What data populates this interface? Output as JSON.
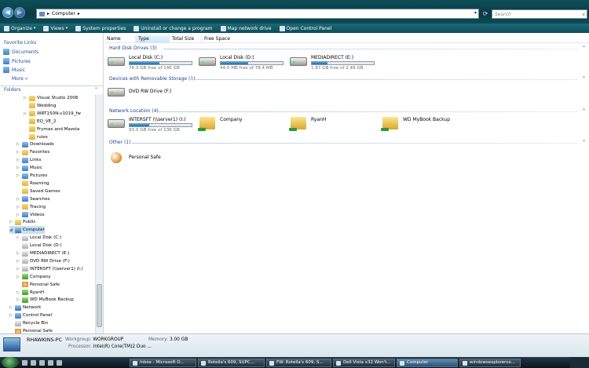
{
  "address": {
    "path": [
      "Computer"
    ]
  },
  "search": {
    "placeholder": "Search"
  },
  "toolbar": [
    {
      "label": "Organize",
      "icon": "organize-icon",
      "dropdown": true
    },
    {
      "label": "Views",
      "icon": "views-icon",
      "dropdown": true
    },
    {
      "label": "System properties",
      "icon": "system-properties-icon"
    },
    {
      "label": "Uninstall or change a program",
      "icon": "uninstall-icon"
    },
    {
      "label": "Map network drive",
      "icon": "map-drive-icon"
    },
    {
      "label": "Open Control Panel",
      "icon": "control-panel-icon"
    }
  ],
  "favorites": {
    "header": "Favorite Links",
    "items": [
      "Documents",
      "Pictures",
      "Music"
    ],
    "more": "More"
  },
  "folders": {
    "header": "Folders"
  },
  "tree": [
    {
      "label": "Visual Studio 2008",
      "icon": "folder",
      "depth": 2,
      "exp": "▷"
    },
    {
      "label": "Wedding",
      "icon": "folder",
      "depth": 2,
      "exp": ""
    },
    {
      "label": "WRT150N-v1019_fw",
      "icon": "folder",
      "depth": 2,
      "exp": "▷"
    },
    {
      "label": "EQ_VE_2",
      "icon": "folder",
      "depth": 2,
      "exp": ""
    },
    {
      "label": "Frymax and Mazola",
      "icon": "folder",
      "depth": 2,
      "exp": ""
    },
    {
      "label": "rules",
      "icon": "folder",
      "depth": 2,
      "exp": ""
    },
    {
      "label": "Downloads",
      "icon": "blue",
      "depth": 1,
      "exp": "▷"
    },
    {
      "label": "Favorites",
      "icon": "folder",
      "depth": 1,
      "exp": "▷"
    },
    {
      "label": "Links",
      "icon": "blue",
      "depth": 1,
      "exp": "▷"
    },
    {
      "label": "Music",
      "icon": "blue",
      "depth": 1,
      "exp": "▷"
    },
    {
      "label": "Pictures",
      "icon": "blue",
      "depth": 1,
      "exp": "▷"
    },
    {
      "label": "Roaming",
      "icon": "folder",
      "depth": 1,
      "exp": ""
    },
    {
      "label": "Saved Games",
      "icon": "folder",
      "depth": 1,
      "exp": ""
    },
    {
      "label": "Searches",
      "icon": "blue",
      "depth": 1,
      "exp": "▷"
    },
    {
      "label": "Tracing",
      "icon": "folder",
      "depth": 1,
      "exp": "▷"
    },
    {
      "label": "Videos",
      "icon": "blue",
      "depth": 1,
      "exp": "▷"
    },
    {
      "label": "Public",
      "icon": "folder",
      "depth": 0,
      "exp": "▷"
    },
    {
      "label": "Computer",
      "icon": "pc",
      "depth": 0,
      "exp": "◢",
      "selected": true
    },
    {
      "label": "Local Disk (C:)",
      "icon": "drive",
      "depth": 1,
      "exp": "▷"
    },
    {
      "label": "Local Disk (D:)",
      "icon": "drive",
      "depth": 1,
      "exp": ""
    },
    {
      "label": "MEDIADIRECT (E:)",
      "icon": "drive",
      "depth": 1,
      "exp": "▷"
    },
    {
      "label": "DVD RW Drive (F:)",
      "icon": "drive",
      "depth": 1,
      "exp": "▷"
    },
    {
      "label": "INTERSFT (\\\\server1) (I:)",
      "icon": "drive",
      "depth": 1,
      "exp": "▷"
    },
    {
      "label": "Company",
      "icon": "green",
      "depth": 1,
      "exp": "▷"
    },
    {
      "label": "Personal Safe",
      "icon": "orange",
      "depth": 1,
      "exp": ""
    },
    {
      "label": "RyanH",
      "icon": "green",
      "depth": 1,
      "exp": "▷"
    },
    {
      "label": "WD MyBook Backup",
      "icon": "green",
      "depth": 1,
      "exp": "▷"
    },
    {
      "label": "Network",
      "icon": "pc",
      "depth": 0,
      "exp": "▷"
    },
    {
      "label": "Control Panel",
      "icon": "blue",
      "depth": 0,
      "exp": "▷"
    },
    {
      "label": "Recycle Bin",
      "icon": "drive",
      "depth": 0,
      "exp": ""
    },
    {
      "label": "Personal Safe",
      "icon": "orange",
      "depth": 0,
      "exp": ""
    }
  ],
  "columns": [
    "Name",
    "Type",
    "Total Size",
    "Free Space"
  ],
  "groups": [
    {
      "title": "Hard Disk Drives (3)",
      "items": [
        {
          "name": "Local Disk (C:)",
          "kind": "hdd",
          "free": "76.3 GB free of 146 GB",
          "used_fraction": 0.48
        },
        {
          "name": "Local Disk (D:)",
          "kind": "hdd",
          "free": "44.0 MB free of 78.4 MB",
          "used_fraction": 0.44
        },
        {
          "name": "MEDIADIRECT (E:)",
          "kind": "hdd",
          "free": "1.87 GB free of 2.49 GB",
          "used_fraction": 0.25
        }
      ]
    },
    {
      "title": "Devices with Removable Storage (1)",
      "items": [
        {
          "name": "DVD RW Drive (F:)",
          "kind": "dvd"
        }
      ]
    },
    {
      "title": "Network Location (4)",
      "items": [
        {
          "name": "INTERSFT (\\\\server1) (I:)",
          "kind": "net",
          "free": "93.0 GB free of 136 GB",
          "used_fraction": 0.32
        },
        {
          "name": "Company",
          "kind": "folder"
        },
        {
          "name": "RyanH",
          "kind": "folder"
        },
        {
          "name": "WD MyBook Backup",
          "kind": "folder"
        }
      ]
    },
    {
      "title": "Other (1)",
      "items": [
        {
          "name": "Personal Safe",
          "kind": "safe"
        }
      ]
    }
  ],
  "details": {
    "computer_name": "RHAWKINS-PC",
    "workgroup_label": "Workgroup:",
    "workgroup": "WORKGROUP",
    "memory_label": "Memory:",
    "memory": "3.00 GB",
    "processor_label": "Processor:",
    "processor": "Intel(R) Core(TM)2 Duo ..."
  },
  "taskbar": [
    {
      "label": "Inbox - Microsoft O..."
    },
    {
      "label": "Rotella's 609, SUPC..."
    },
    {
      "label": "FW: Rotella's 609, S..."
    },
    {
      "label": "Dell Vista x32 Won't..."
    },
    {
      "label": "Computer",
      "active": true
    },
    {
      "label": "windowsexplorerco..."
    }
  ]
}
